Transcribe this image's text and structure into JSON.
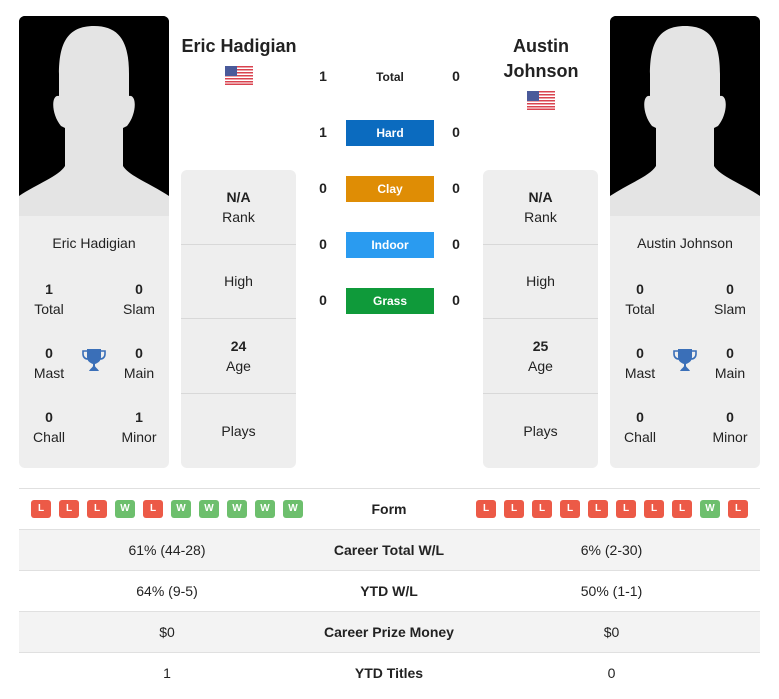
{
  "players": {
    "left": {
      "name": "Eric Hadigian",
      "flag": "us-flag",
      "card_name": "Eric Hadigian",
      "titles": {
        "total": {
          "value": "1",
          "label": "Total"
        },
        "slam": {
          "value": "0",
          "label": "Slam"
        },
        "mast": {
          "value": "0",
          "label": "Mast"
        },
        "main": {
          "value": "0",
          "label": "Main"
        },
        "chall": {
          "value": "0",
          "label": "Chall"
        },
        "minor": {
          "value": "1",
          "label": "Minor"
        }
      },
      "info": {
        "rank": {
          "value": "N/A",
          "label": "Rank"
        },
        "high": {
          "value": "",
          "label": "High"
        },
        "age": {
          "value": "24",
          "label": "Age"
        },
        "plays": {
          "value": "",
          "label": "Plays"
        }
      },
      "form": [
        "L",
        "L",
        "L",
        "W",
        "L",
        "W",
        "W",
        "W",
        "W",
        "W"
      ]
    },
    "right": {
      "name": "Austin Johnson",
      "flag": "us-flag",
      "card_name": "Austin Johnson",
      "titles": {
        "total": {
          "value": "0",
          "label": "Total"
        },
        "slam": {
          "value": "0",
          "label": "Slam"
        },
        "mast": {
          "value": "0",
          "label": "Mast"
        },
        "main": {
          "value": "0",
          "label": "Main"
        },
        "chall": {
          "value": "0",
          "label": "Chall"
        },
        "minor": {
          "value": "0",
          "label": "Minor"
        }
      },
      "info": {
        "rank": {
          "value": "N/A",
          "label": "Rank"
        },
        "high": {
          "value": "",
          "label": "High"
        },
        "age": {
          "value": "25",
          "label": "Age"
        },
        "plays": {
          "value": "",
          "label": "Plays"
        }
      },
      "form": [
        "L",
        "L",
        "L",
        "L",
        "L",
        "L",
        "L",
        "L",
        "W",
        "L"
      ]
    }
  },
  "h2h": [
    {
      "label": "Total",
      "left": "1",
      "right": "0",
      "color": ""
    },
    {
      "label": "Hard",
      "left": "1",
      "right": "0",
      "color": "#0b6bbf"
    },
    {
      "label": "Clay",
      "left": "0",
      "right": "0",
      "color": "#df8d05"
    },
    {
      "label": "Indoor",
      "left": "0",
      "right": "0",
      "color": "#2a9bf0"
    },
    {
      "label": "Grass",
      "left": "0",
      "right": "0",
      "color": "#0f9a3a"
    }
  ],
  "stats": [
    {
      "label": "Form",
      "left": "",
      "right": ""
    },
    {
      "label": "Career Total W/L",
      "left": "61% (44-28)",
      "right": "6% (2-30)"
    },
    {
      "label": "YTD W/L",
      "left": "64% (9-5)",
      "right": "50% (1-1)"
    },
    {
      "label": "Career Prize Money",
      "left": "$0",
      "right": "$0"
    },
    {
      "label": "YTD Titles",
      "left": "1",
      "right": "0"
    }
  ],
  "colors": {
    "loss": "#ec5a47",
    "win": "#6dbf6d",
    "trophy": "#3a6fb8"
  }
}
